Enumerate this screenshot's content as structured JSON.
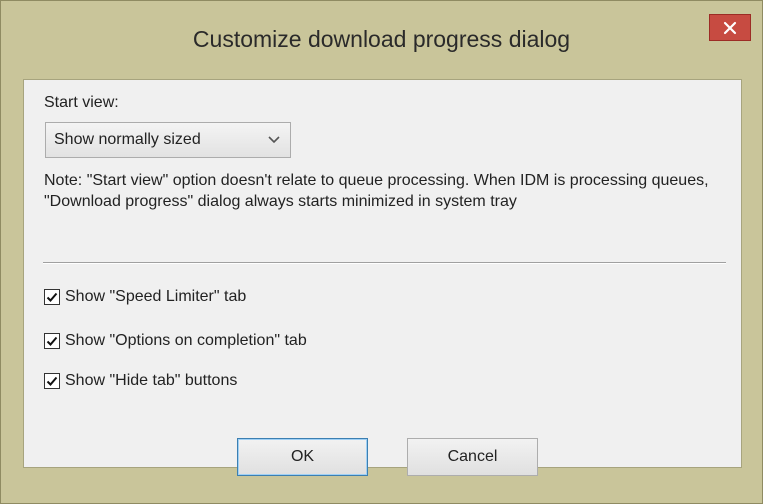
{
  "window": {
    "title": "Customize download progress dialog",
    "close_glyph": "×"
  },
  "start_view": {
    "label": "Start view:",
    "selected": "Show normally sized"
  },
  "note": "Note: \"Start view\" option doesn't relate to queue processing. When IDM is processing queues,  \"Download progress\" dialog always starts minimized in system tray",
  "checkboxes": [
    {
      "label": "Show \"Speed Limiter\" tab",
      "checked": true
    },
    {
      "label": "Show \"Options on completion\" tab",
      "checked": true
    },
    {
      "label": "Show \"Hide tab\" buttons",
      "checked": true
    }
  ],
  "buttons": {
    "ok": "OK",
    "cancel": "Cancel"
  },
  "colors": {
    "frame": "#c9c59a",
    "close_button": "#c74b41",
    "client_background": "#f0f0f0"
  }
}
